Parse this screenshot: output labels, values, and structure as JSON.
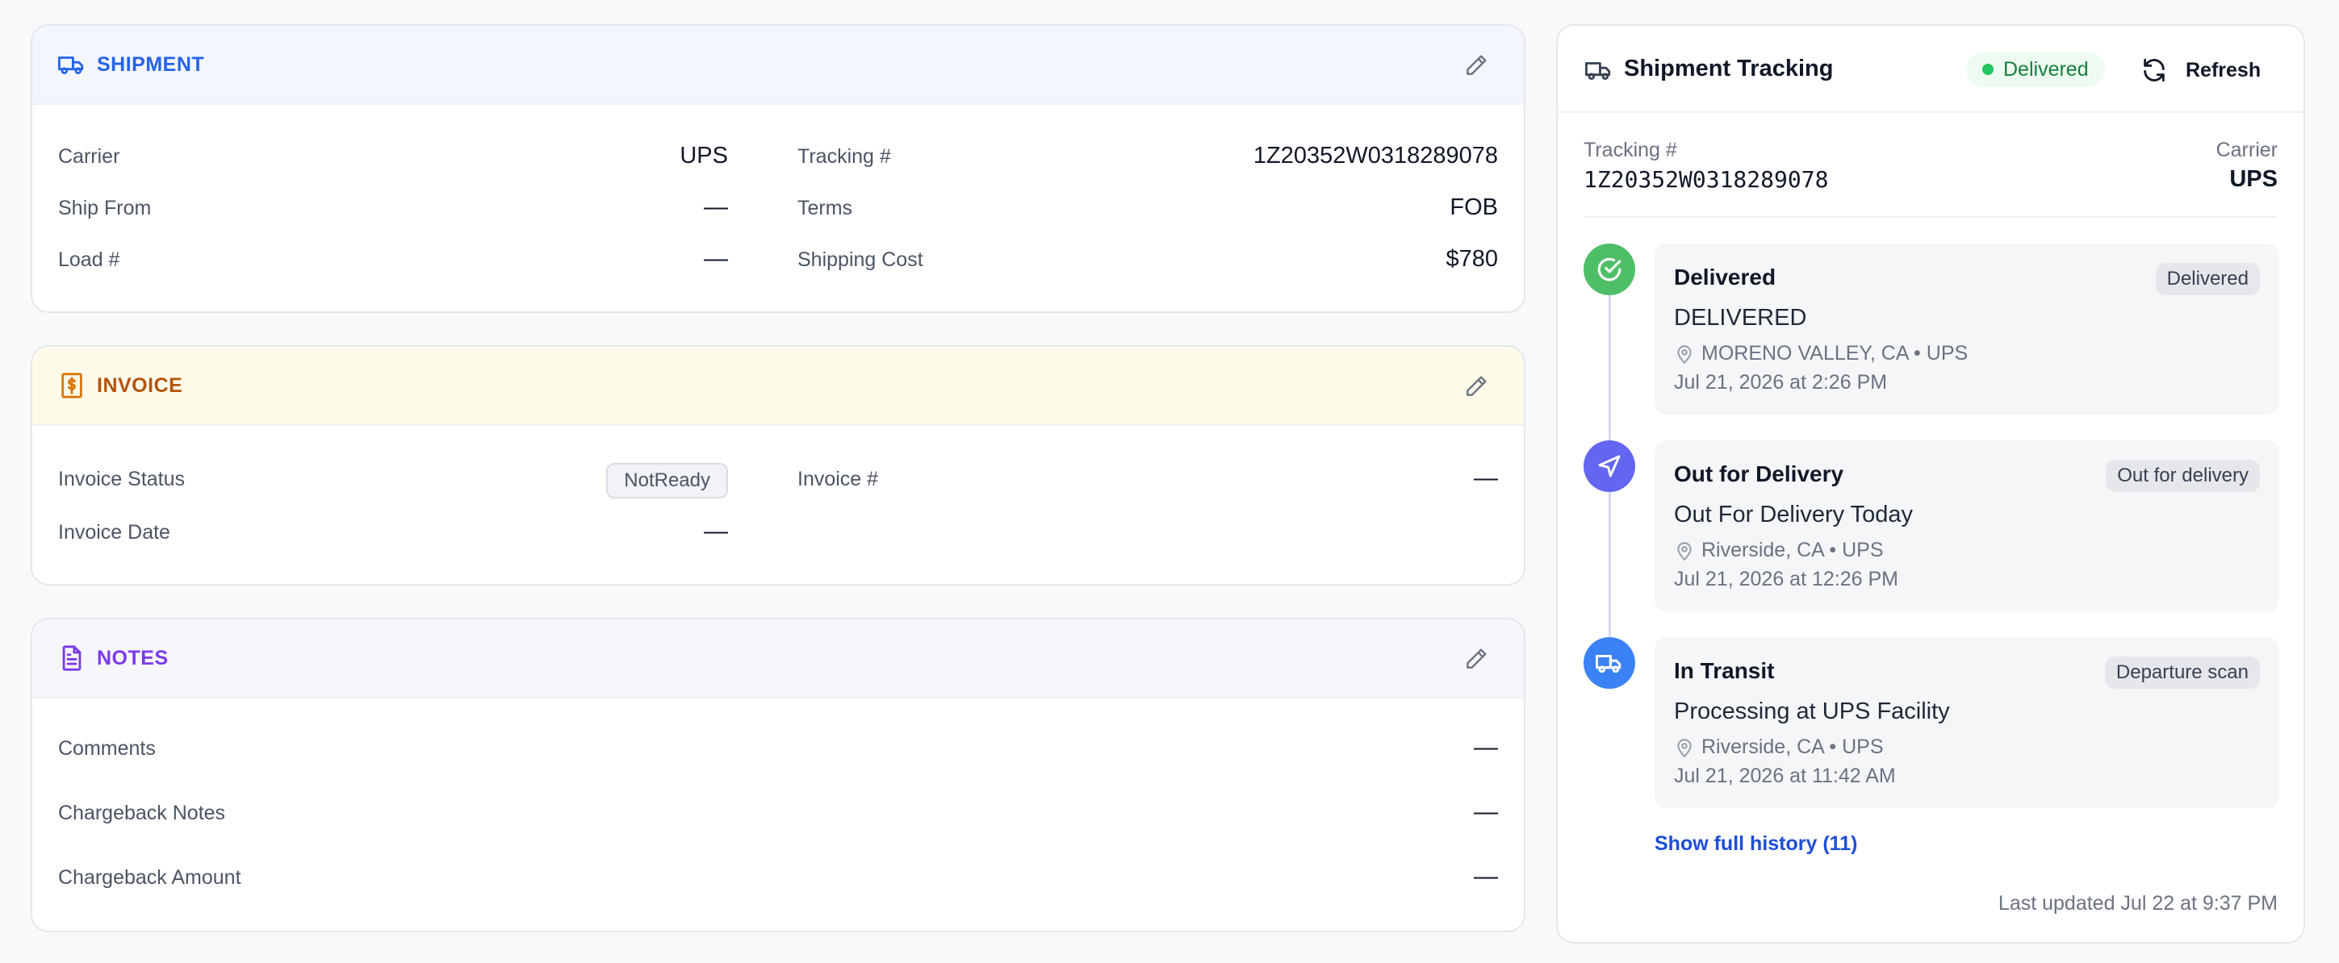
{
  "shipment": {
    "title": "SHIPMENT",
    "accent": "#2563eb",
    "header_bg": "#f3f6fd",
    "carrier_label": "Carrier",
    "carrier_value": "UPS",
    "ship_from_label": "Ship From",
    "ship_from_value": "—",
    "load_label": "Load #",
    "load_value": "—",
    "tracking_label": "Tracking #",
    "tracking_value": "1Z20352W0318289078",
    "terms_label": "Terms",
    "terms_value": "FOB",
    "cost_label": "Shipping Cost",
    "cost_value": "$780"
  },
  "invoice": {
    "title": "INVOICE",
    "accent": "#b45309",
    "header_bg": "#fffbeb",
    "status_label": "Invoice Status",
    "status_value": "NotReady",
    "number_label": "Invoice #",
    "number_value": "—",
    "date_label": "Invoice Date",
    "date_value": "—"
  },
  "notes": {
    "title": "NOTES",
    "accent": "#7c3aed",
    "header_bg": "#f6f6fb",
    "comments_label": "Comments",
    "comments_value": "—",
    "chargeback_notes_label": "Chargeback Notes",
    "chargeback_notes_value": "—",
    "chargeback_amount_label": "Chargeback Amount",
    "chargeback_amount_value": "—"
  },
  "tracking": {
    "title": "Shipment Tracking",
    "status": "Delivered",
    "refresh_label": "Refresh",
    "tracking_label": "Tracking #",
    "tracking_value": "1Z20352W0318289078",
    "carrier_label": "Carrier",
    "carrier_value": "UPS",
    "events": [
      {
        "title": "Delivered",
        "badge": "Delivered",
        "desc": "DELIVERED",
        "location": "MORENO VALLEY, CA • UPS",
        "time": "Jul 21, 2026 at 2:26 PM",
        "icon": "check-circle-icon",
        "color": "#4fbf67"
      },
      {
        "title": "Out for Delivery",
        "badge": "Out for delivery",
        "desc": "Out For Delivery Today",
        "location": "Riverside, CA • UPS",
        "time": "Jul 21, 2026 at 12:26 PM",
        "icon": "navigation-arrow-icon",
        "color": "#6366f1"
      },
      {
        "title": "In Transit",
        "badge": "Departure scan",
        "desc": "Processing at UPS Facility",
        "location": "Riverside, CA • UPS",
        "time": "Jul 21, 2026 at 11:42 AM",
        "icon": "truck-icon",
        "color": "#3b82f6"
      }
    ],
    "history_link": "Show full history (11)",
    "last_updated": "Last updated Jul 22 at 9:37 PM"
  }
}
